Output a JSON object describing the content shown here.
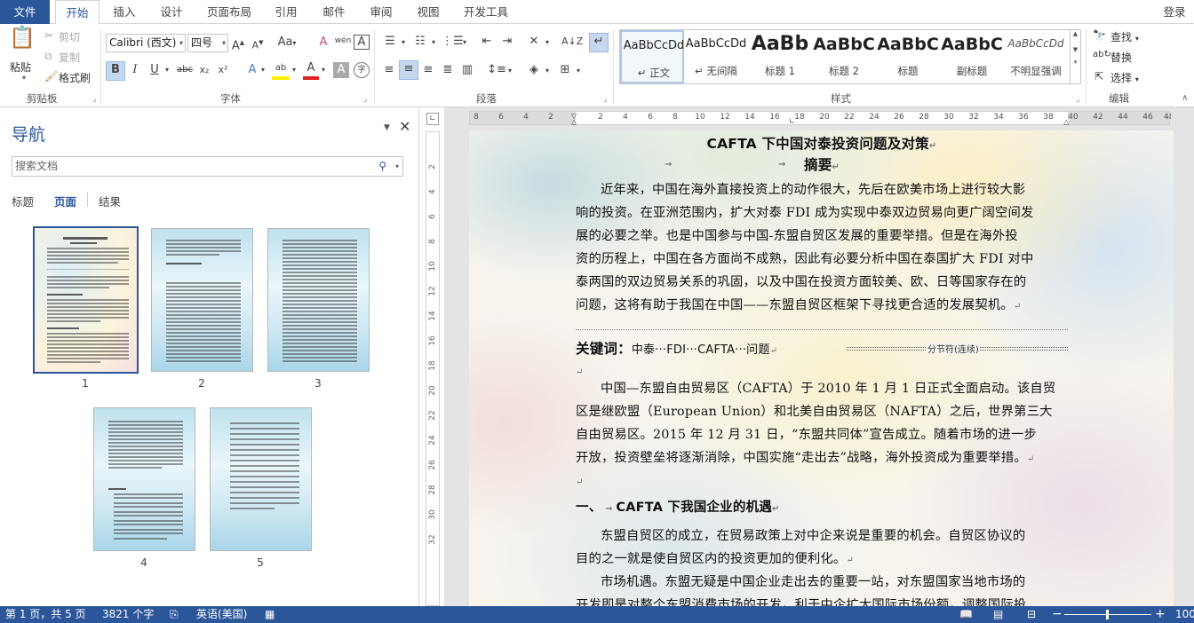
{
  "tabs": {
    "file": "文件",
    "home": "开始",
    "insert": "插入",
    "design": "设计",
    "layout": "页面布局",
    "references": "引用",
    "mailings": "邮件",
    "review": "审阅",
    "view": "视图",
    "developer": "开发工具",
    "signin": "登录"
  },
  "clipboard": {
    "paste": "粘贴",
    "cut": "剪切",
    "copy": "复制",
    "painter": "格式刷",
    "label": "剪贴板"
  },
  "font": {
    "name": "Calibri (西文)",
    "size": "四号",
    "label": "字体",
    "bold": "B",
    "italic": "I",
    "underline": "U",
    "strike": "abc",
    "sub": "x₂",
    "sup": "x²",
    "grow": "A",
    "shrink": "A",
    "case": "Aa",
    "wen": "wén",
    "border_a": "A",
    "text_effect": "A",
    "highlight": "ab",
    "color": "A",
    "shade": "A",
    "circle": "字"
  },
  "paragraph": {
    "label": "段落"
  },
  "styles": {
    "label": "样式",
    "items": [
      {
        "preview": "AaBbCcDd",
        "name": "↵ 正文"
      },
      {
        "preview": "AaBbCcDd",
        "name": "↵ 无间隔"
      },
      {
        "preview": "AaBb",
        "name": "标题 1"
      },
      {
        "preview": "AaBbC",
        "name": "标题 2"
      },
      {
        "preview": "AaBbC",
        "name": "标题"
      },
      {
        "preview": "AaBbC",
        "name": "副标题"
      },
      {
        "preview": "AaBbCcDd",
        "name": "不明显强调"
      }
    ]
  },
  "editing": {
    "find": "查找",
    "replace": "替换",
    "select": "选择",
    "label": "编辑"
  },
  "nav": {
    "title": "导航",
    "search_placeholder": "搜索文档",
    "tabs": [
      "标题",
      "页面",
      "结果"
    ],
    "pages": [
      "1",
      "2",
      "3",
      "4",
      "5"
    ]
  },
  "ruler": {
    "h": [
      "8",
      "6",
      "4",
      "2",
      "",
      "2",
      "4",
      "6",
      "8",
      "10",
      "12",
      "14",
      "16",
      "18",
      "20",
      "22",
      "24",
      "26",
      "28",
      "30",
      "32",
      "34",
      "36",
      "38",
      "40",
      "42",
      "44",
      "46",
      "48"
    ],
    "v": [
      "2",
      "4",
      "6",
      "8",
      "10",
      "12",
      "14",
      "16",
      "18",
      "20",
      "22",
      "24",
      "26",
      "28",
      "30",
      "32"
    ]
  },
  "doc": {
    "title": "CAFTA 下中国对泰投资问题及对策",
    "abstract_heading": "摘要",
    "abstract": [
      "近年来，中国在海外直接投资上的动作很大，先后在欧美市场上进行较大影",
      "响的投资。在亚洲范围内，扩大对泰 FDI 成为实现中泰双边贸易向更广阔空间发",
      "展的必要之举。也是中国参与中国-东盟自贸区发展的重要举措。但是在海外投",
      "资的历程上，中国在各方面尚不成熟，因此有必要分析中国在泰国扩大 FDI 对中",
      "泰两国的双边贸易关系的巩固，以及中国在投资方面较美、欧、日等国家存在的",
      "问题，这将有助于我国在中国——东盟自贸区框架下寻找更合适的发展契机。"
    ],
    "keywords_label": "关键词：",
    "keywords": "中泰···FDI···CAFTA···问题",
    "section_break": "分节符(连续)",
    "intro": [
      "中国—东盟自由贸易区（CAFTA）于 2010 年 1 月 1 日正式全面启动。该自贸",
      "区是继欧盟（European Union）和北美自由贸易区（NAFTA）之后，世界第三大",
      "自由贸易区。2015 年 12 月 31 日，“东盟共同体”宣告成立。随着市场的进一步",
      "开放，投资壁垒将逐渐消除，中国实施“走出去”战略，海外投资成为重要举措。"
    ],
    "section1_num": "一、",
    "section1_title": "CAFTA 下我国企业的机遇",
    "section1_p1": [
      "东盟自贸区的成立，在贸易政策上对中企来说是重要的机会。自贸区协议的",
      "目的之一就是使自贸区内的投资更加的便利化。"
    ],
    "section1_p2": [
      "市场机遇。东盟无疑是中国企业走出去的重要一站，对东盟国家当地市场的",
      "开发即是对整个东盟消费市场的开发，利于中企扩大国际市场份额，调整国际投"
    ]
  },
  "status": {
    "page": "第 1 页，共 5 页",
    "words": "3821 个字",
    "lang": "英语(美国)",
    "zoom": "100"
  }
}
